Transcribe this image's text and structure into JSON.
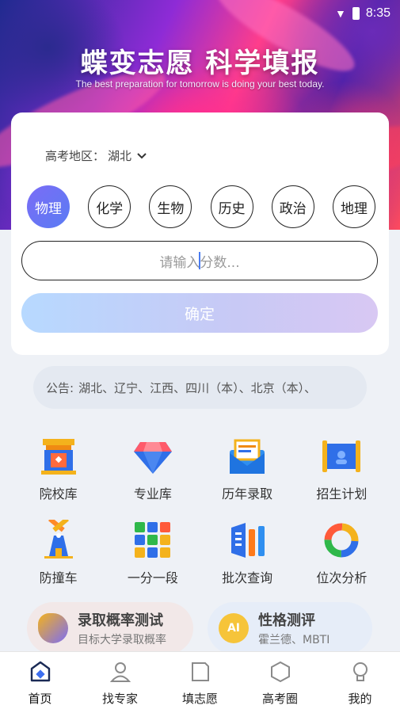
{
  "status_bar": {
    "time": "8:35"
  },
  "banner": {
    "title": "蝶变志愿 科学填报",
    "subtitle": "The best preparation for tomorrow is doing your best today."
  },
  "form": {
    "region_label": "高考地区：",
    "region_value": "湖北",
    "subjects": [
      {
        "label": "物理",
        "selected": true
      },
      {
        "label": "化学",
        "selected": false
      },
      {
        "label": "生物",
        "selected": false
      },
      {
        "label": "历史",
        "selected": false
      },
      {
        "label": "政治",
        "selected": false
      },
      {
        "label": "地理",
        "selected": false
      }
    ],
    "score_placeholder": "请输入分数...",
    "confirm_label": "确定"
  },
  "notice": {
    "label": "公告:",
    "text": "湖北、辽宁、江西、四川（本）、北京（本）、"
  },
  "features": [
    {
      "label": "院校库",
      "icon": "university-icon"
    },
    {
      "label": "专业库",
      "icon": "diamond-icon"
    },
    {
      "label": "历年录取",
      "icon": "envelope-icon"
    },
    {
      "label": "招生计划",
      "icon": "scroll-icon"
    },
    {
      "label": "防撞车",
      "icon": "windmill-icon"
    },
    {
      "label": "一分一段",
      "icon": "grid-icon"
    },
    {
      "label": "批次查询",
      "icon": "bars-icon"
    },
    {
      "label": "位次分析",
      "icon": "donut-chart-icon"
    }
  ],
  "promos": [
    {
      "title": "录取概率测试",
      "subtitle": "目标大学录取概率"
    },
    {
      "title": "性格测评",
      "subtitle": "霍兰德、MBTI",
      "icon_text": "AI"
    }
  ],
  "nav": [
    {
      "label": "首页",
      "icon": "home-icon",
      "active": true
    },
    {
      "label": "找专家",
      "icon": "expert-icon",
      "active": false
    },
    {
      "label": "填志愿",
      "icon": "form-icon",
      "active": false
    },
    {
      "label": "高考圈",
      "icon": "hexagon-icon",
      "active": false
    },
    {
      "label": "我的",
      "icon": "profile-icon",
      "active": false
    }
  ],
  "colors": {
    "accent": "#5a7cf3",
    "confirm_gradient_start": "#b7d9ff",
    "confirm_gradient_end": "#d8c8f3"
  }
}
